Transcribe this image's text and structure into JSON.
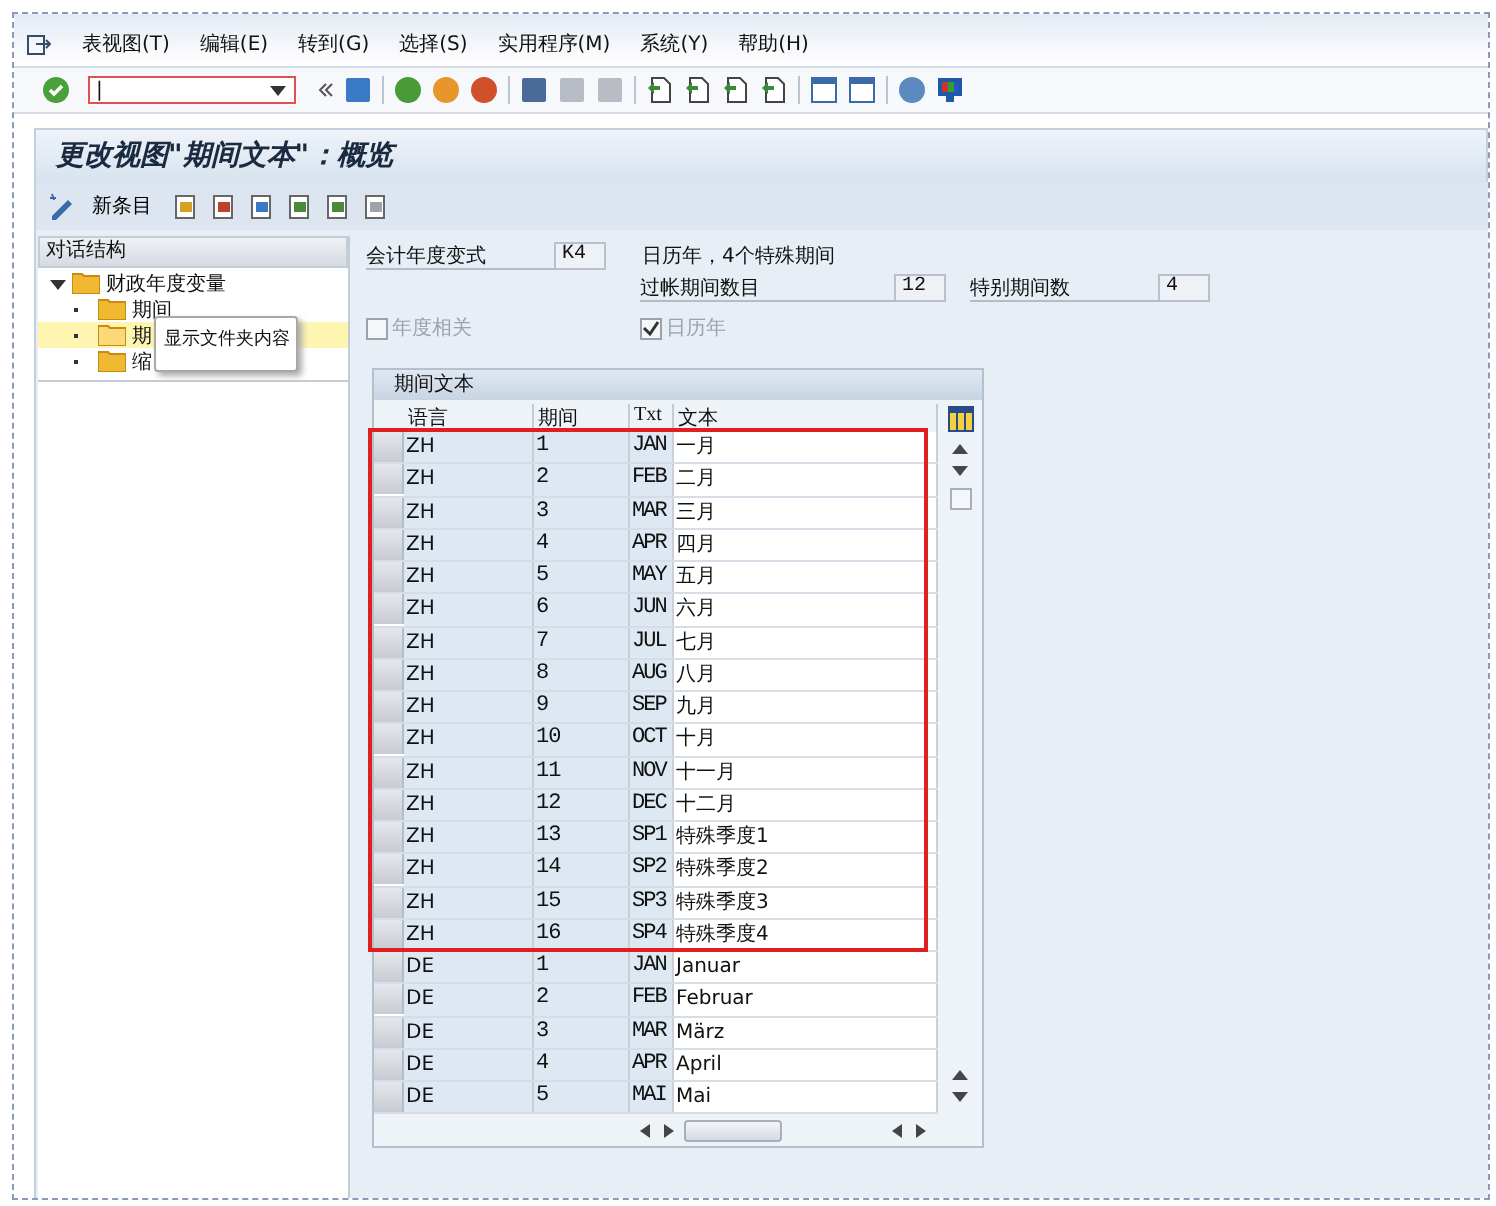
{
  "menu": [
    "表视图(T)",
    "编辑(E)",
    "转到(G)",
    "选择(S)",
    "实用程序(M)",
    "系统(Y)",
    "帮助(H)"
  ],
  "command_field": {
    "value": "|"
  },
  "screen_title": "更改视图\"期间文本\"：概览",
  "app_toolbar": {
    "new_entries": "新条目"
  },
  "dialog_structure": {
    "title": "对话结构",
    "items": [
      {
        "label": "财政年度变量",
        "expanded": true,
        "selected": false,
        "children": [
          {
            "label": "期间",
            "selected": false
          },
          {
            "label": "期",
            "selected": true
          },
          {
            "label": "缩",
            "selected": false
          }
        ]
      }
    ]
  },
  "tooltip": "显示文件夹内容",
  "form": {
    "variant_label": "会计年度变式",
    "variant_value": "K4",
    "variant_desc": "日历年，4个特殊期间",
    "posting_label": "过帐期间数目",
    "posting_value": "12",
    "special_label": "特别期间数",
    "special_value": "4",
    "year_dependent": {
      "label": "年度相关",
      "checked": false,
      "disabled": true
    },
    "calendar_year": {
      "label": "日历年",
      "checked": true,
      "disabled": true
    }
  },
  "table": {
    "title": "期间文本",
    "columns": [
      "语言",
      "期间",
      "Txt",
      "文本"
    ],
    "rows": [
      {
        "lang": "ZH",
        "period": "1",
        "txt": "JAN",
        "text": "一月",
        "highlighted": true
      },
      {
        "lang": "ZH",
        "period": "2",
        "txt": "FEB",
        "text": "二月",
        "highlighted": true
      },
      {
        "lang": "ZH",
        "period": "3",
        "txt": "MAR",
        "text": "三月",
        "highlighted": true
      },
      {
        "lang": "ZH",
        "period": "4",
        "txt": "APR",
        "text": "四月",
        "highlighted": true
      },
      {
        "lang": "ZH",
        "period": "5",
        "txt": "MAY",
        "text": "五月",
        "highlighted": true
      },
      {
        "lang": "ZH",
        "period": "6",
        "txt": "JUN",
        "text": "六月",
        "highlighted": true
      },
      {
        "lang": "ZH",
        "period": "7",
        "txt": "JUL",
        "text": "七月",
        "highlighted": true
      },
      {
        "lang": "ZH",
        "period": "8",
        "txt": "AUG",
        "text": "八月",
        "highlighted": true
      },
      {
        "lang": "ZH",
        "period": "9",
        "txt": "SEP",
        "text": "九月",
        "highlighted": true
      },
      {
        "lang": "ZH",
        "period": "10",
        "txt": "OCT",
        "text": "十月",
        "highlighted": true
      },
      {
        "lang": "ZH",
        "period": "11",
        "txt": "NOV",
        "text": "十一月",
        "highlighted": true
      },
      {
        "lang": "ZH",
        "period": "12",
        "txt": "DEC",
        "text": "十二月",
        "highlighted": true
      },
      {
        "lang": "ZH",
        "period": "13",
        "txt": "SP1",
        "text": "特殊季度1",
        "highlighted": true
      },
      {
        "lang": "ZH",
        "period": "14",
        "txt": "SP2",
        "text": "特殊季度2",
        "highlighted": true
      },
      {
        "lang": "ZH",
        "period": "15",
        "txt": "SP3",
        "text": "特殊季度3",
        "highlighted": true
      },
      {
        "lang": "ZH",
        "period": "16",
        "txt": "SP4",
        "text": "特殊季度4",
        "highlighted": true
      },
      {
        "lang": "DE",
        "period": "1",
        "txt": "JAN",
        "text": "Januar",
        "highlighted": false
      },
      {
        "lang": "DE",
        "period": "2",
        "txt": "FEB",
        "text": "Februar",
        "highlighted": false
      },
      {
        "lang": "DE",
        "period": "3",
        "txt": "MAR",
        "text": "März",
        "highlighted": false
      },
      {
        "lang": "DE",
        "period": "4",
        "txt": "APR",
        "text": "April",
        "highlighted": false
      },
      {
        "lang": "DE",
        "period": "5",
        "txt": "MAI",
        "text": "Mai",
        "highlighted": false
      }
    ]
  }
}
